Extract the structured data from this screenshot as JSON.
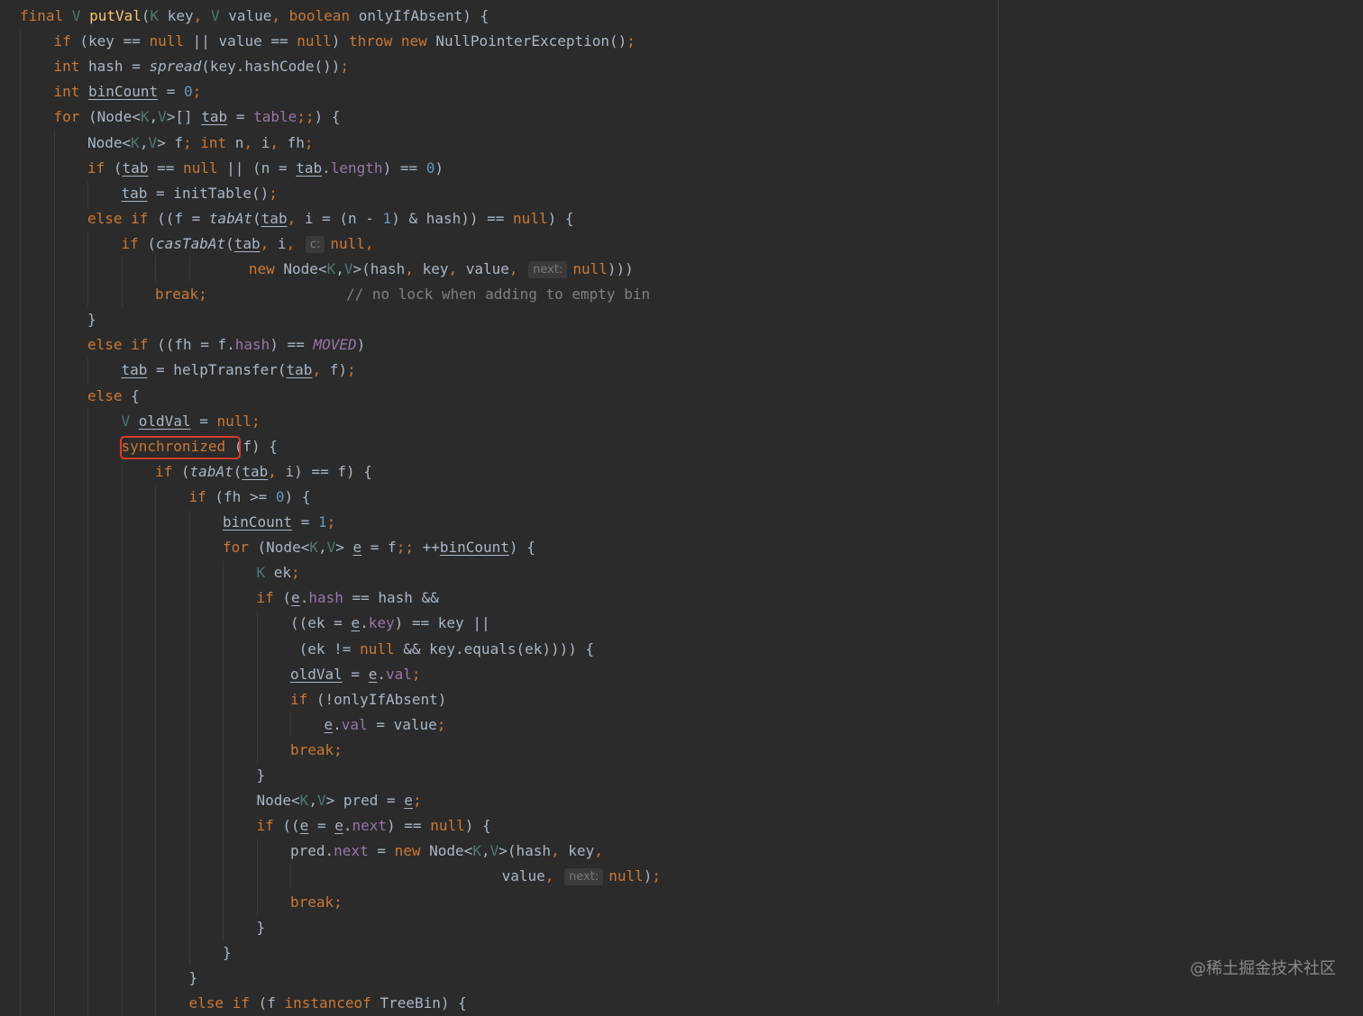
{
  "editor": {
    "language": "java",
    "theme_colors": {
      "background": "#2b2b2b",
      "keyword": "#cc7832",
      "type_param": "#507874",
      "method_decl": "#ffc66d",
      "number": "#6897bb",
      "comment": "#808080",
      "field": "#9876aa",
      "text": "#a9b7c6",
      "highlight_box": "#e0392b"
    },
    "lines": [
      {
        "indent": 0,
        "tokens": [
          {
            "t": "final ",
            "c": "kw"
          },
          {
            "t": "V ",
            "c": "tp"
          },
          {
            "t": "putVal",
            "c": "fn"
          },
          {
            "t": "("
          },
          {
            "t": "K ",
            "c": "tp"
          },
          {
            "t": "key"
          },
          {
            "t": ", ",
            "c": "kw"
          },
          {
            "t": "V ",
            "c": "tp"
          },
          {
            "t": "value"
          },
          {
            "t": ", ",
            "c": "kw"
          },
          {
            "t": "boolean ",
            "c": "kw"
          },
          {
            "t": "onlyIfAbsent) {"
          }
        ]
      },
      {
        "indent": 1,
        "tokens": [
          {
            "t": "if ",
            "c": "kw"
          },
          {
            "t": "(key == "
          },
          {
            "t": "null ",
            "c": "kw"
          },
          {
            "t": "|| value == "
          },
          {
            "t": "null",
            "c": "kw"
          },
          {
            "t": ") "
          },
          {
            "t": "throw new ",
            "c": "kw"
          },
          {
            "t": "NullPointerException()"
          },
          {
            "t": ";",
            "c": "kw"
          }
        ]
      },
      {
        "indent": 1,
        "tokens": [
          {
            "t": "int ",
            "c": "kw"
          },
          {
            "t": "hash = "
          },
          {
            "t": "spread",
            "c": "it"
          },
          {
            "t": "(key.hashCode())"
          },
          {
            "t": ";",
            "c": "kw"
          }
        ]
      },
      {
        "indent": 1,
        "tokens": [
          {
            "t": "int ",
            "c": "kw"
          },
          {
            "t": "binCount",
            "c": "ul"
          },
          {
            "t": " = "
          },
          {
            "t": "0",
            "c": "num"
          },
          {
            "t": ";",
            "c": "kw"
          }
        ]
      },
      {
        "indent": 1,
        "tokens": [
          {
            "t": "for ",
            "c": "kw"
          },
          {
            "t": "(Node<"
          },
          {
            "t": "K",
            "c": "tp"
          },
          {
            "t": ","
          },
          {
            "t": "V",
            "c": "tp"
          },
          {
            "t": ">[] "
          },
          {
            "t": "tab",
            "c": "ul"
          },
          {
            "t": " = "
          },
          {
            "t": "table",
            "c": "fld"
          },
          {
            "t": ";;",
            "c": "kw"
          },
          {
            "t": ") {"
          }
        ]
      },
      {
        "indent": 2,
        "tokens": [
          {
            "t": "Node<"
          },
          {
            "t": "K",
            "c": "tp"
          },
          {
            "t": ","
          },
          {
            "t": "V",
            "c": "tp"
          },
          {
            "t": "> f"
          },
          {
            "t": "; ",
            "c": "kw"
          },
          {
            "t": "int ",
            "c": "kw"
          },
          {
            "t": "n"
          },
          {
            "t": ", ",
            "c": "kw"
          },
          {
            "t": "i"
          },
          {
            "t": ", ",
            "c": "kw"
          },
          {
            "t": "fh"
          },
          {
            "t": ";",
            "c": "kw"
          }
        ]
      },
      {
        "indent": 2,
        "tokens": [
          {
            "t": "if ",
            "c": "kw"
          },
          {
            "t": "("
          },
          {
            "t": "tab",
            "c": "ul"
          },
          {
            "t": " == "
          },
          {
            "t": "null ",
            "c": "kw"
          },
          {
            "t": "|| (n = "
          },
          {
            "t": "tab",
            "c": "ul"
          },
          {
            "t": "."
          },
          {
            "t": "length",
            "c": "fld"
          },
          {
            "t": ") == "
          },
          {
            "t": "0",
            "c": "num"
          },
          {
            "t": ")"
          }
        ]
      },
      {
        "indent": 3,
        "tokens": [
          {
            "t": "tab",
            "c": "ul"
          },
          {
            "t": " = initTable()"
          },
          {
            "t": ";",
            "c": "kw"
          }
        ]
      },
      {
        "indent": 2,
        "tokens": [
          {
            "t": "else if ",
            "c": "kw"
          },
          {
            "t": "((f = "
          },
          {
            "t": "tabAt",
            "c": "it"
          },
          {
            "t": "("
          },
          {
            "t": "tab",
            "c": "ul"
          },
          {
            "t": ", ",
            "c": "kw"
          },
          {
            "t": "i = (n - "
          },
          {
            "t": "1",
            "c": "num"
          },
          {
            "t": ") & hash)) == "
          },
          {
            "t": "null",
            "c": "kw"
          },
          {
            "t": ") {"
          }
        ]
      },
      {
        "indent": 3,
        "tokens": [
          {
            "t": "if ",
            "c": "kw"
          },
          {
            "t": "("
          },
          {
            "t": "casTabAt",
            "c": "it"
          },
          {
            "t": "("
          },
          {
            "t": "tab",
            "c": "ul"
          },
          {
            "t": ", ",
            "c": "kw"
          },
          {
            "t": "i"
          },
          {
            "t": ", ",
            "c": "kw"
          },
          {
            "t": "c:",
            "c": "hint"
          },
          {
            "t": "null",
            "c": "kw"
          },
          {
            "t": ",",
            "c": "kw"
          }
        ]
      },
      {
        "indent": 6,
        "pad": 3,
        "tokens": [
          {
            "t": "new ",
            "c": "kw"
          },
          {
            "t": "Node<"
          },
          {
            "t": "K",
            "c": "tp"
          },
          {
            "t": ","
          },
          {
            "t": "V",
            "c": "tp"
          },
          {
            "t": ">(hash"
          },
          {
            "t": ", ",
            "c": "kw"
          },
          {
            "t": "key"
          },
          {
            "t": ", ",
            "c": "kw"
          },
          {
            "t": "value"
          },
          {
            "t": ", ",
            "c": "kw"
          },
          {
            "t": "next:",
            "c": "hint"
          },
          {
            "t": "null",
            "c": "kw"
          },
          {
            "t": ")))"
          }
        ]
      },
      {
        "indent": 4,
        "tokens": [
          {
            "t": "break",
            "c": "kw"
          },
          {
            "t": ";",
            "c": "kw"
          },
          {
            "t": "                "
          },
          {
            "t": "// no lock when adding to empty bin",
            "c": "cm"
          }
        ]
      },
      {
        "indent": 2,
        "tokens": [
          {
            "t": "}"
          }
        ]
      },
      {
        "indent": 2,
        "tokens": [
          {
            "t": "else if ",
            "c": "kw"
          },
          {
            "t": "((fh = f."
          },
          {
            "t": "hash",
            "c": "fld"
          },
          {
            "t": ") == "
          },
          {
            "t": "MOVED",
            "c": "fldi"
          },
          {
            "t": ")"
          }
        ]
      },
      {
        "indent": 3,
        "tokens": [
          {
            "t": "tab",
            "c": "ul"
          },
          {
            "t": " = helpTransfer("
          },
          {
            "t": "tab",
            "c": "ul"
          },
          {
            "t": ", ",
            "c": "kw"
          },
          {
            "t": "f)"
          },
          {
            "t": ";",
            "c": "kw"
          }
        ]
      },
      {
        "indent": 2,
        "tokens": [
          {
            "t": "else ",
            "c": "kw"
          },
          {
            "t": "{"
          }
        ]
      },
      {
        "indent": 3,
        "tokens": [
          {
            "t": "V ",
            "c": "tp"
          },
          {
            "t": "oldVal",
            "c": "ul"
          },
          {
            "t": " = "
          },
          {
            "t": "null",
            "c": "kw"
          },
          {
            "t": ";",
            "c": "kw"
          }
        ]
      },
      {
        "indent": 3,
        "tokens": [
          {
            "t": "synchronized ",
            "c": "kw"
          },
          {
            "t": "(f) {"
          }
        ]
      },
      {
        "indent": 4,
        "tokens": [
          {
            "t": "if ",
            "c": "kw"
          },
          {
            "t": "("
          },
          {
            "t": "tabAt",
            "c": "it"
          },
          {
            "t": "("
          },
          {
            "t": "tab",
            "c": "ul"
          },
          {
            "t": ", ",
            "c": "kw"
          },
          {
            "t": "i) == f) {"
          }
        ]
      },
      {
        "indent": 5,
        "tokens": [
          {
            "t": "if ",
            "c": "kw"
          },
          {
            "t": "(fh >= "
          },
          {
            "t": "0",
            "c": "num"
          },
          {
            "t": ") {"
          }
        ]
      },
      {
        "indent": 6,
        "tokens": [
          {
            "t": "binCount",
            "c": "ul"
          },
          {
            "t": " = "
          },
          {
            "t": "1",
            "c": "num"
          },
          {
            "t": ";",
            "c": "kw"
          }
        ]
      },
      {
        "indent": 6,
        "tokens": [
          {
            "t": "for ",
            "c": "kw"
          },
          {
            "t": "(Node<"
          },
          {
            "t": "K",
            "c": "tp"
          },
          {
            "t": ","
          },
          {
            "t": "V",
            "c": "tp"
          },
          {
            "t": "> "
          },
          {
            "t": "e",
            "c": "ul"
          },
          {
            "t": " = f"
          },
          {
            "t": ";; ",
            "c": "kw"
          },
          {
            "t": "++"
          },
          {
            "t": "binCount",
            "c": "ul"
          },
          {
            "t": ") {"
          }
        ]
      },
      {
        "indent": 7,
        "tokens": [
          {
            "t": "K ",
            "c": "tp"
          },
          {
            "t": "ek"
          },
          {
            "t": ";",
            "c": "kw"
          }
        ]
      },
      {
        "indent": 7,
        "tokens": [
          {
            "t": "if ",
            "c": "kw"
          },
          {
            "t": "("
          },
          {
            "t": "e",
            "c": "ul"
          },
          {
            "t": "."
          },
          {
            "t": "hash",
            "c": "fld"
          },
          {
            "t": " == hash &&"
          }
        ]
      },
      {
        "indent": 8,
        "tokens": [
          {
            "t": "((ek = "
          },
          {
            "t": "e",
            "c": "ul"
          },
          {
            "t": "."
          },
          {
            "t": "key",
            "c": "fld"
          },
          {
            "t": ") == key ||"
          }
        ]
      },
      {
        "indent": 8,
        "pad": 1,
        "tokens": [
          {
            "t": "(ek != "
          },
          {
            "t": "null ",
            "c": "kw"
          },
          {
            "t": "&& key.equals(ek)))) {"
          }
        ]
      },
      {
        "indent": 8,
        "tokens": [
          {
            "t": "oldVal",
            "c": "ul"
          },
          {
            "t": " = "
          },
          {
            "t": "e",
            "c": "ul"
          },
          {
            "t": "."
          },
          {
            "t": "val",
            "c": "fld"
          },
          {
            "t": ";",
            "c": "kw"
          }
        ]
      },
      {
        "indent": 8,
        "tokens": [
          {
            "t": "if ",
            "c": "kw"
          },
          {
            "t": "(!onlyIfAbsent)"
          }
        ]
      },
      {
        "indent": 9,
        "tokens": [
          {
            "t": "e",
            "c": "ul"
          },
          {
            "t": "."
          },
          {
            "t": "val",
            "c": "fld"
          },
          {
            "t": " = value"
          },
          {
            "t": ";",
            "c": "kw"
          }
        ]
      },
      {
        "indent": 8,
        "tokens": [
          {
            "t": "break",
            "c": "kw"
          },
          {
            "t": ";",
            "c": "kw"
          }
        ]
      },
      {
        "indent": 7,
        "tokens": [
          {
            "t": "}"
          }
        ]
      },
      {
        "indent": 7,
        "tokens": [
          {
            "t": "Node<"
          },
          {
            "t": "K",
            "c": "tp"
          },
          {
            "t": ","
          },
          {
            "t": "V",
            "c": "tp"
          },
          {
            "t": "> pred = "
          },
          {
            "t": "e",
            "c": "ul"
          },
          {
            "t": ";",
            "c": "kw"
          }
        ]
      },
      {
        "indent": 7,
        "tokens": [
          {
            "t": "if ",
            "c": "kw"
          },
          {
            "t": "(("
          },
          {
            "t": "e",
            "c": "ul"
          },
          {
            "t": " = "
          },
          {
            "t": "e",
            "c": "ul"
          },
          {
            "t": "."
          },
          {
            "t": "next",
            "c": "fld"
          },
          {
            "t": ") == "
          },
          {
            "t": "null",
            "c": "kw"
          },
          {
            "t": ") {"
          }
        ]
      },
      {
        "indent": 8,
        "tokens": [
          {
            "t": "pred."
          },
          {
            "t": "next",
            "c": "fld"
          },
          {
            "t": " = "
          },
          {
            "t": "new ",
            "c": "kw"
          },
          {
            "t": "Node<"
          },
          {
            "t": "K",
            "c": "tp"
          },
          {
            "t": ","
          },
          {
            "t": "V",
            "c": "tp"
          },
          {
            "t": ">(hash"
          },
          {
            "t": ", ",
            "c": "kw"
          },
          {
            "t": "key"
          },
          {
            "t": ",",
            "c": "kw"
          }
        ]
      },
      {
        "indent": 14,
        "pad": 1,
        "tokens": [
          {
            "t": "value"
          },
          {
            "t": ", ",
            "c": "kw"
          },
          {
            "t": "next:",
            "c": "hint"
          },
          {
            "t": "null",
            "c": "kw"
          },
          {
            "t": ")"
          },
          {
            "t": ";",
            "c": "kw"
          }
        ]
      },
      {
        "indent": 8,
        "tokens": [
          {
            "t": "break",
            "c": "kw"
          },
          {
            "t": ";",
            "c": "kw"
          }
        ]
      },
      {
        "indent": 7,
        "tokens": [
          {
            "t": "}"
          }
        ]
      },
      {
        "indent": 6,
        "tokens": [
          {
            "t": "}"
          }
        ]
      },
      {
        "indent": 5,
        "tokens": [
          {
            "t": "}"
          }
        ]
      },
      {
        "indent": 5,
        "tokens": [
          {
            "t": "else if ",
            "c": "kw"
          },
          {
            "t": "(f "
          },
          {
            "t": "instanceof ",
            "c": "kw"
          },
          {
            "t": "TreeBin) {"
          }
        ]
      }
    ]
  },
  "watermark": "@稀土掘金技术社区"
}
